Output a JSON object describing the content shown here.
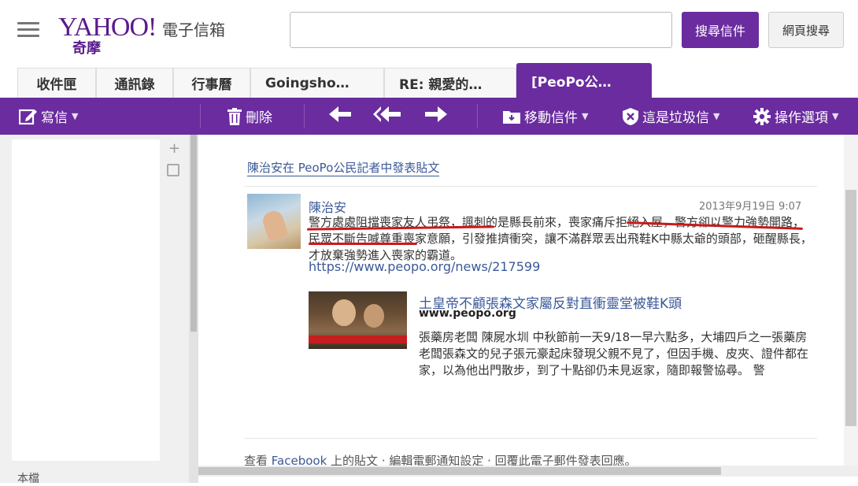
{
  "header": {
    "logo_text": "YAHOO!",
    "logo_sub": "奇摩",
    "service_name": "電子信箱",
    "search_placeholder": "",
    "search_mail_button": "搜尋信件",
    "search_web_button": "網頁搜尋"
  },
  "tabs": [
    {
      "label": "收件匣"
    },
    {
      "label": "通訊錄"
    },
    {
      "label": "行事曆"
    },
    {
      "label": "Goingsho…"
    },
    {
      "label": "RE: 親愛的…"
    },
    {
      "label": "[PeoPo公…"
    }
  ],
  "toolbar": {
    "compose": "寫信",
    "delete": "刪除",
    "move": "移動信件",
    "spam": "這是垃圾信",
    "actions": "操作選項"
  },
  "left": {
    "bottom_label": "本檔"
  },
  "message": {
    "fb_header": "陳治安在 PeoPo公民記者中發表貼文",
    "author": "陳治安",
    "date": "2013年9月19日 9:07",
    "body": "警方處處阻擋喪家友人弔祭，諷刺的是縣長前來，喪家痛斥拒絕入屋，警方卻以警力強勢開路，民眾不斷告喊尊重喪家意願，引發推擠衝突，讓不滿群眾丟出飛鞋K中縣太爺的頭部，砸醒縣長，才放棄強勢進入喪家的霸道。",
    "url": "https://www.peopo.org/news/217599",
    "news_title": "土皇帝不顧張森文家屬反對直衝靈堂被鞋K頭",
    "news_domain": "www.peopo.org",
    "news_desc": "張藥房老闆 陳屍水圳 中秋節前一天9/18一早六點多，大埔四戶之一張藥房老闆張森文的兒子張元豪起床發現父親不見了，但因手機、皮夾、證件都在家，以為他出門散步，到了十點卻仍未見返家，隨即報警協尋。 警",
    "footer_prefix": "查看",
    "footer_link": "Facebook",
    "footer_rest": " 上的貼文 · 編輯電郵通知設定 · 回覆此電子郵件發表回應。"
  }
}
